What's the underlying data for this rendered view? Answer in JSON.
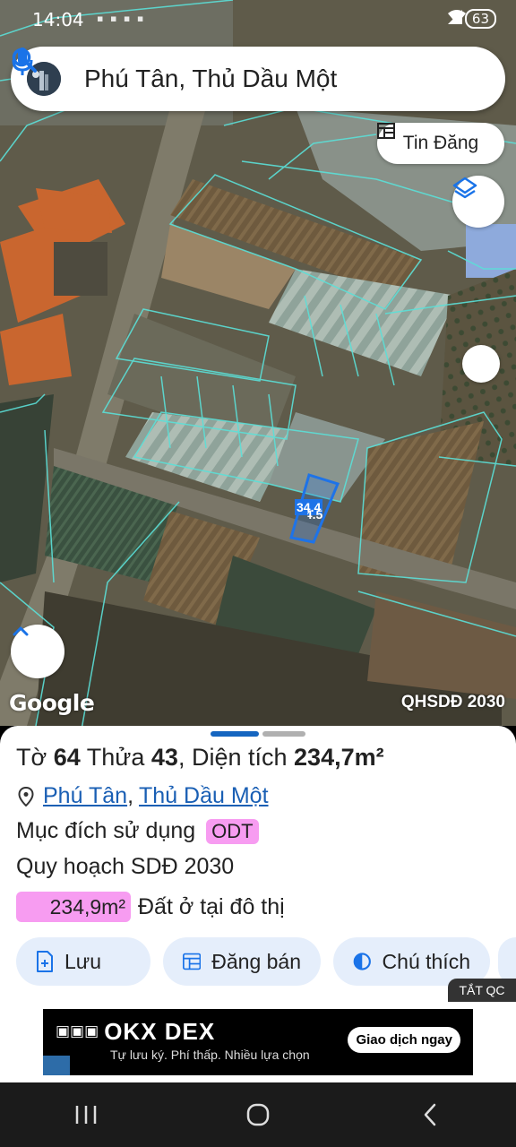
{
  "status": {
    "time": "14:04",
    "battery": "63"
  },
  "search": {
    "query": "Phú Tân, Thủ Dầu Một"
  },
  "map": {
    "tin_dang_label": "Tin Đăng",
    "google_label": "Google",
    "layer_label": "QHSDĐ 2030",
    "parcel_width_label": "34.4",
    "parcel_depth_label": "34.5"
  },
  "parcel": {
    "sheet_prefix": "Tờ",
    "sheet_no": "64",
    "lot_prefix": "Thửa",
    "lot_no": "43",
    "area_prefix": ", Diện tích",
    "area_value": "234,7m²",
    "ward": "Phú Tân",
    "city": "Thủ Dầu Một",
    "purpose_label": "Mục đích sử dụng",
    "purpose_code": "ODT",
    "plan_label": "Quy hoạch SDĐ 2030",
    "plan_area": "234,9m²",
    "plan_use": "Đất ở tại đô thị"
  },
  "actions": {
    "save": "Lưu",
    "sell": "Đăng bán",
    "legend": "Chú thích"
  },
  "ad": {
    "close_label": "TẮT QC",
    "brand": "OKX DEX",
    "tagline": "Tự lưu ký. Phí thấp. Nhiều lựa chọn",
    "cta": "Giao dịch ngay"
  },
  "colors": {
    "accent": "#1a73e8",
    "badge": "#f79cf1",
    "chip": "#e5eefb"
  }
}
